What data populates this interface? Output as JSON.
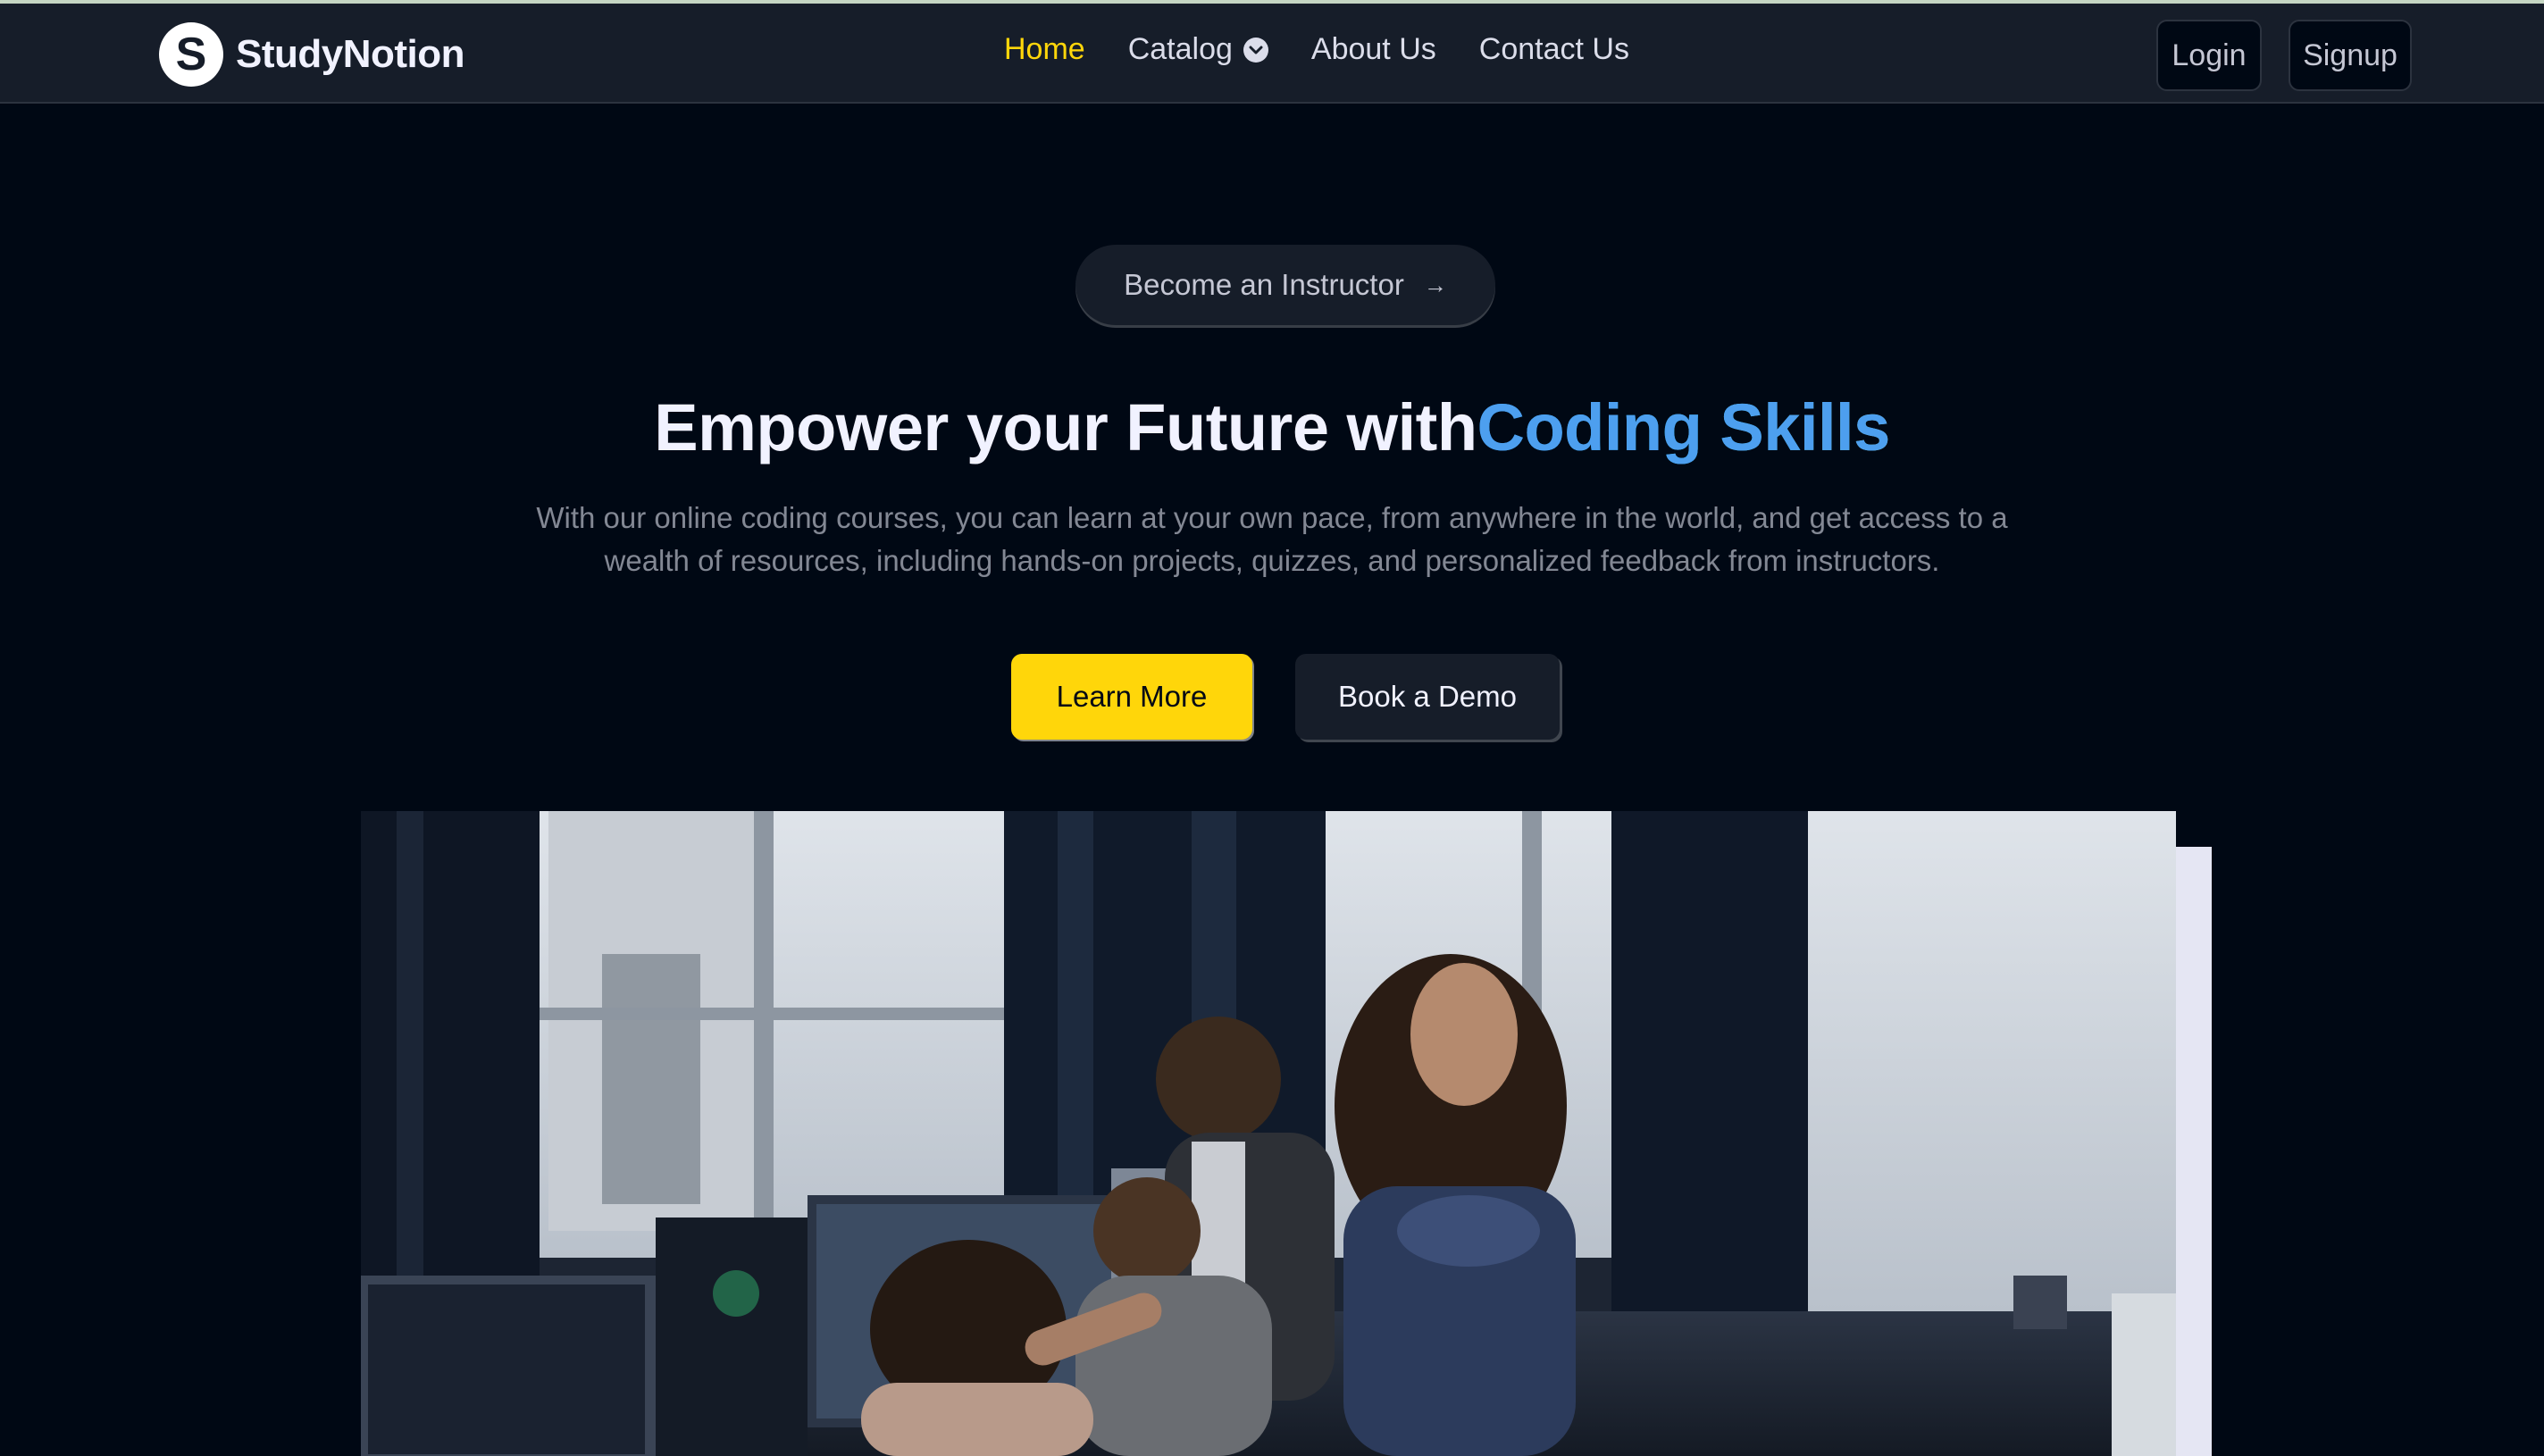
{
  "brand": {
    "logo_letter": "S",
    "name": "StudyNotion"
  },
  "nav": {
    "items": [
      {
        "label": "Home",
        "active": true
      },
      {
        "label": "Catalog",
        "active": false
      },
      {
        "label": "About Us",
        "active": false
      },
      {
        "label": "Contact Us",
        "active": false
      }
    ],
    "catalog_icon": "chevron-down-circle-icon",
    "login": "Login",
    "signup": "Signup"
  },
  "hero": {
    "instructor_pill": "Become an Instructor",
    "instructor_arrow": "→",
    "headline_plain": "Empower your Future with",
    "headline_highlight": "Coding Skills",
    "subtext": "With our online coding courses, you can learn at your own pace, from anywhere in the world, and get access to a wealth of resources, including hands-on projects, quizzes, and personalized feedback from instructors.",
    "cta_primary": "Learn More",
    "cta_secondary": "Book a Demo"
  },
  "colors": {
    "background": "#000814",
    "navbar": "#161d29",
    "accent_yellow": "#ffd60a",
    "highlight_blue": "#4d9fef",
    "muted_text": "#838894"
  }
}
